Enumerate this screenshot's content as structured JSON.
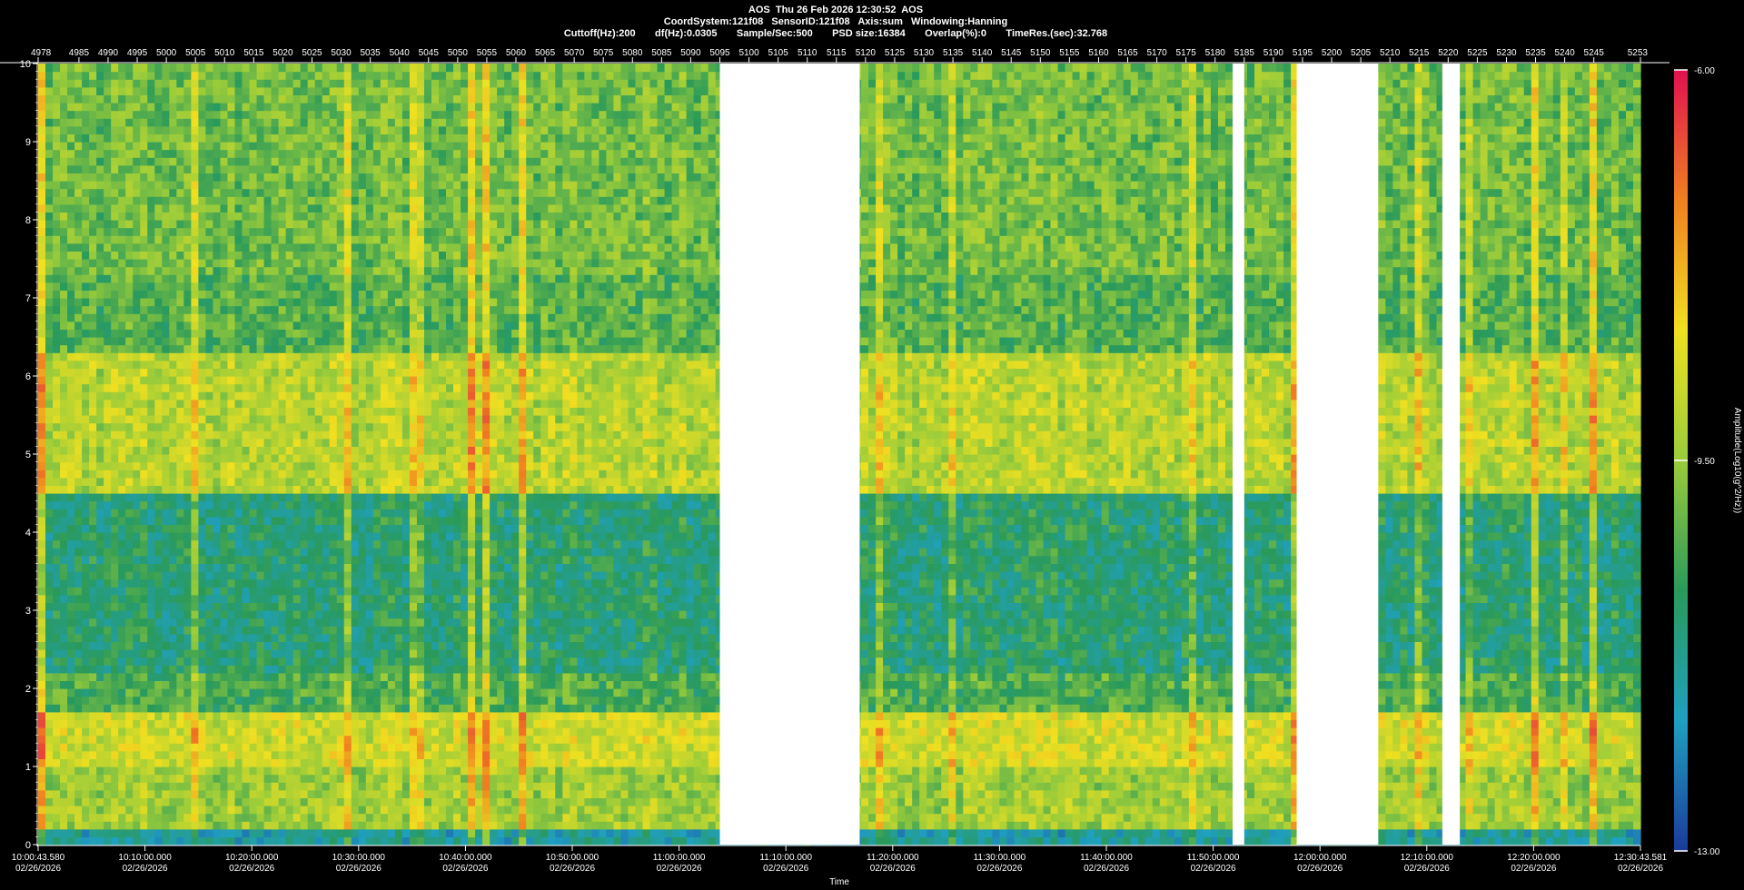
{
  "header": {
    "line1": "AOS  Thu 26 Feb 2026 12:30:52  AOS",
    "line2": "CoordSystem:121f08   SensorID:121f08   Axis:sum   Windowing:Hanning",
    "line3": "Cuttoff(Hz):200       df(Hz):0.0305       Sample/Sec:500       PSD size:16384       Overlap(%):0       TimeRes.(sec):32.768"
  },
  "chart_data": {
    "type": "heatmap",
    "title": "",
    "xlabel": "Time",
    "ylabel": "",
    "colorbar_label": "Amplitude(Log10(g^2/Hz))",
    "ylim": [
      0,
      10
    ],
    "y_ticks": [
      "0",
      "1",
      "2",
      "3",
      "4",
      "5",
      "6",
      "7",
      "8",
      "9",
      "10"
    ],
    "colorbar_ticks": [
      "-6.00",
      "-9.50",
      "-13.00"
    ],
    "colorbar_range": [
      -13.0,
      -6.0
    ],
    "colorbar_colors": [
      "#1a3a9a",
      "#1fa0c0",
      "#2a9a5a",
      "#9acc3a",
      "#f0e020",
      "#f08020",
      "#e01050"
    ],
    "x_index_ticks": [
      "4978",
      "4985",
      "4990",
      "4995",
      "5000",
      "5005",
      "5010",
      "5015",
      "5020",
      "5025",
      "5030",
      "5035",
      "5040",
      "5045",
      "5050",
      "5055",
      "5060",
      "5065",
      "5070",
      "5075",
      "5080",
      "5085",
      "5090",
      "5095",
      "5100",
      "5105",
      "5110",
      "5115",
      "5120",
      "5125",
      "5130",
      "5135",
      "5140",
      "5145",
      "5150",
      "5155",
      "5160",
      "5165",
      "5170",
      "5175",
      "5180",
      "5185",
      "5190",
      "5195",
      "5200",
      "5205",
      "5210",
      "5215",
      "5220",
      "5225",
      "5230",
      "5235",
      "5240",
      "5245",
      "5253"
    ],
    "x_index_range": [
      4978,
      5253
    ],
    "x_time_ticks": [
      {
        "time": "10:00:43.580",
        "date": "02/26/2026"
      },
      {
        "time": "10:10:00.000",
        "date": "02/26/2026"
      },
      {
        "time": "10:20:00.000",
        "date": "02/26/2026"
      },
      {
        "time": "10:30:00.000",
        "date": "02/26/2026"
      },
      {
        "time": "10:40:00.000",
        "date": "02/26/2026"
      },
      {
        "time": "10:50:00.000",
        "date": "02/26/2026"
      },
      {
        "time": "11:00:00.000",
        "date": "02/26/2026"
      },
      {
        "time": "11:10:00.000",
        "date": "02/26/2026"
      },
      {
        "time": "11:20:00.000",
        "date": "02/26/2026"
      },
      {
        "time": "11:30:00.000",
        "date": "02/26/2026"
      },
      {
        "time": "11:40:00.000",
        "date": "02/26/2026"
      },
      {
        "time": "11:50:00.000",
        "date": "02/26/2026"
      },
      {
        "time": "12:00:00.000",
        "date": "02/26/2026"
      },
      {
        "time": "12:10:00.000",
        "date": "02/26/2026"
      },
      {
        "time": "12:20:00.000",
        "date": "02/26/2026"
      },
      {
        "time": "12:30:43.581",
        "date": "02/26/2026"
      }
    ],
    "gaps_index": [
      [
        5095,
        5119
      ],
      [
        5183,
        5185
      ],
      [
        5194,
        5208
      ],
      [
        5219,
        5222
      ]
    ],
    "frequency_bands": [
      {
        "y_range": [
          0.0,
          0.2
        ],
        "level": -11.5
      },
      {
        "y_range": [
          0.2,
          1.0
        ],
        "level": -9.4
      },
      {
        "y_range": [
          1.0,
          1.7
        ],
        "level": -8.8
      },
      {
        "y_range": [
          1.7,
          2.2
        ],
        "level": -10.3
      },
      {
        "y_range": [
          2.2,
          4.5
        ],
        "level": -10.9
      },
      {
        "y_range": [
          4.5,
          6.3
        ],
        "level": -9.1
      },
      {
        "y_range": [
          6.3,
          7.3
        ],
        "level": -10.2
      },
      {
        "y_range": [
          7.3,
          10.0
        ],
        "level": -9.9
      }
    ]
  }
}
